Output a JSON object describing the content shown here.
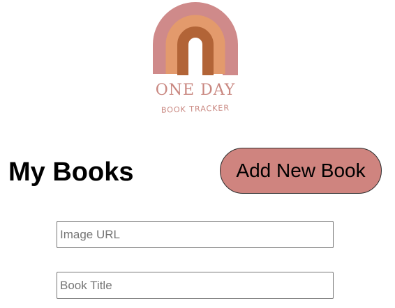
{
  "brand": {
    "title": "ONE DAY",
    "subtitle": "BOOK TRACKER",
    "colors": {
      "outer_arch": "#cf8a8a",
      "middle_arch": "#e39a6c",
      "inner_arch": "#b26437",
      "text": "#c98780"
    }
  },
  "header": {
    "title": "My Books",
    "add_button_label": "Add New Book",
    "add_button_color": "#cf847f"
  },
  "form": {
    "image_url": {
      "placeholder": "Image URL",
      "value": ""
    },
    "book_title": {
      "placeholder": "Book Title",
      "value": ""
    }
  }
}
